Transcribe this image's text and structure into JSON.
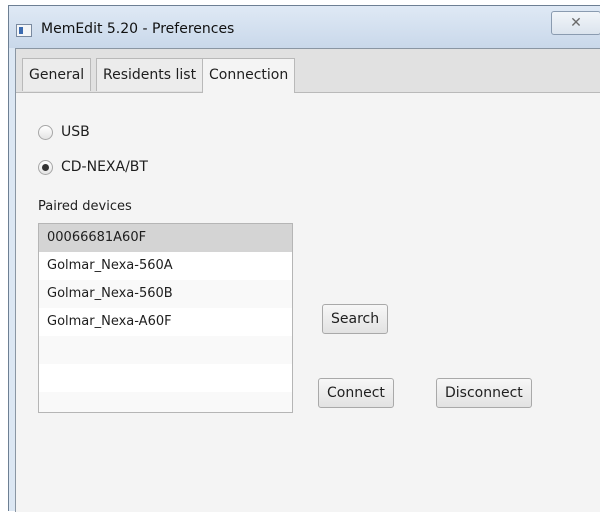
{
  "window": {
    "title": "MemEdit 5.20 - Preferences",
    "close_glyph": "✕"
  },
  "tabs": [
    {
      "label": "General"
    },
    {
      "label": "Residents list"
    },
    {
      "label": "Connection",
      "active": true
    }
  ],
  "connection": {
    "usb_label": "USB",
    "usb_selected": false,
    "nexa_label": "CD-NEXA/BT",
    "nexa_selected": true,
    "paired_label": "Paired devices",
    "devices": [
      "00066681A60F",
      "Golmar_Nexa-560A",
      "Golmar_Nexa-560B",
      "Golmar_Nexa-A60F"
    ],
    "selected_device_index": 0,
    "search_label": "Search",
    "connect_label": "Connect",
    "disconnect_label": "Disconnect"
  }
}
